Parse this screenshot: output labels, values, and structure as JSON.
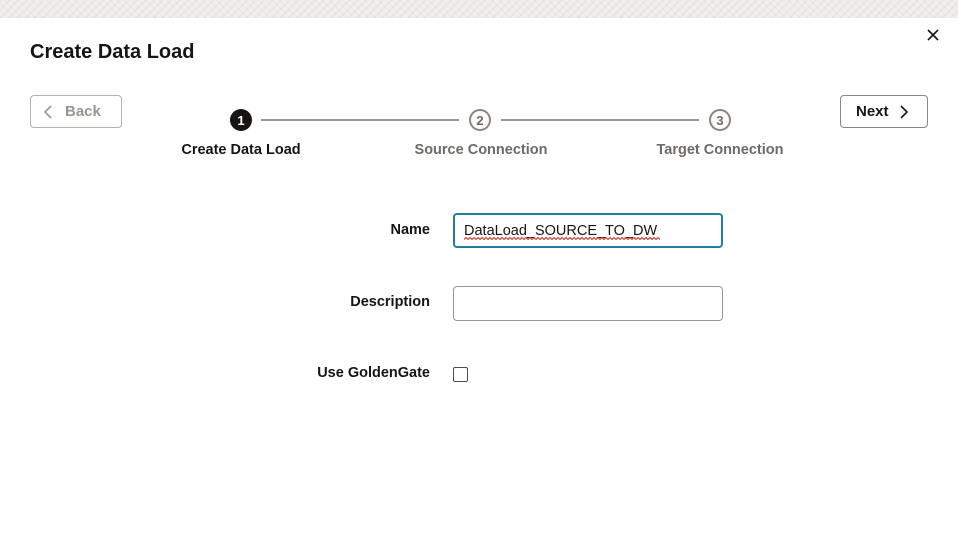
{
  "dialog": {
    "title": "Create Data Load",
    "close_icon": "close-icon"
  },
  "nav": {
    "back_label": "Back",
    "next_label": "Next",
    "back_icon": "chevron-left-icon",
    "next_icon": "chevron-right-icon"
  },
  "steps": [
    {
      "number": "1",
      "label": "Create Data Load",
      "state": "active"
    },
    {
      "number": "2",
      "label": "Source Connection",
      "state": "inactive"
    },
    {
      "number": "3",
      "label": "Target Connection",
      "state": "inactive"
    }
  ],
  "form": {
    "name_label": "Name",
    "name_value": "DataLoad_SOURCE_TO_DW",
    "description_label": "Description",
    "description_value": "",
    "goldengate_label": "Use GoldenGate",
    "goldengate_checked": false
  },
  "colors": {
    "focus_border": "#227e9e",
    "active_step": "#161513",
    "inactive_step": "#8b8680",
    "spellcheck_underline": "#d93025"
  }
}
